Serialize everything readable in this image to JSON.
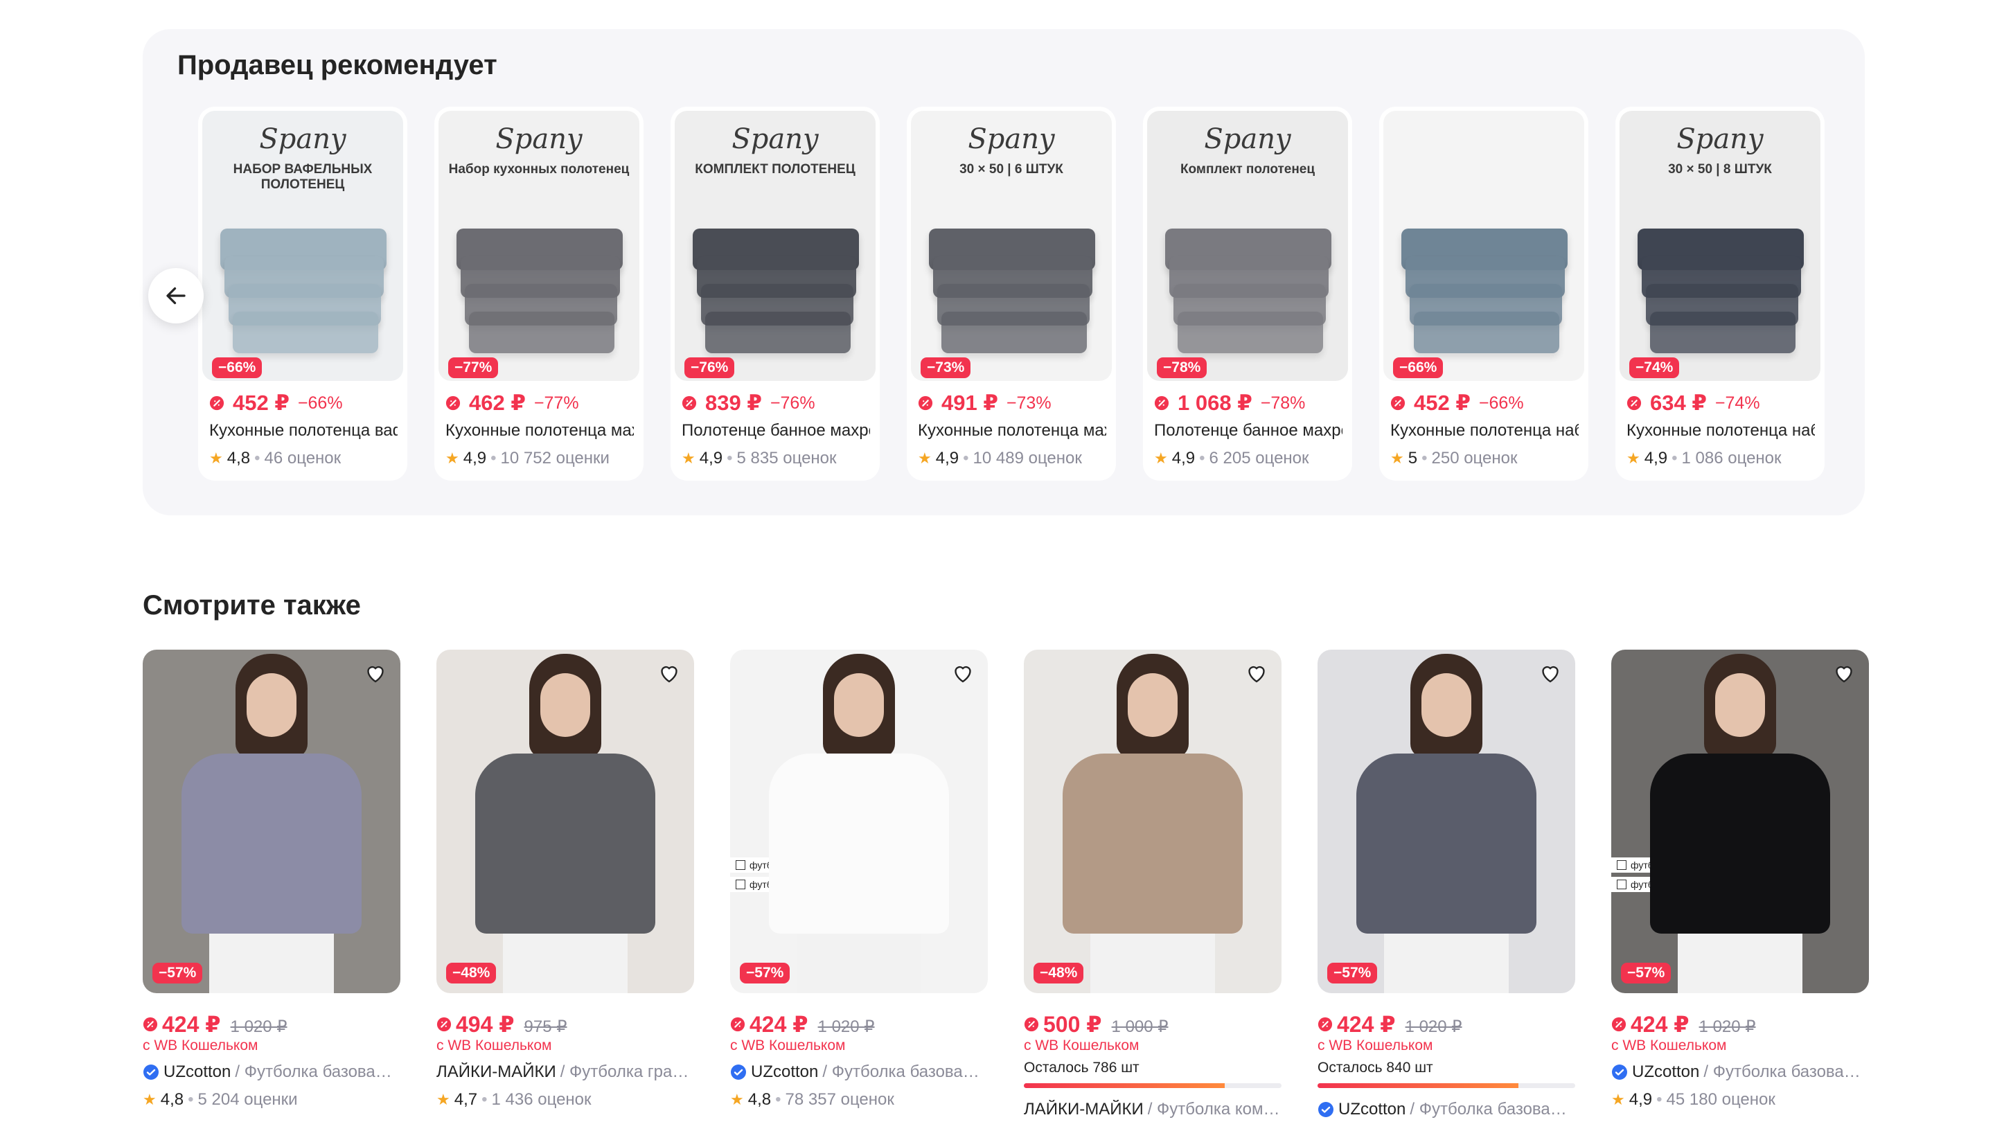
{
  "recommend": {
    "title": "Продавец рекомендует",
    "prev_icon": "arrow-left-icon",
    "cards": [
      {
        "brand": "Spany",
        "caption": "НАБОР ВАФЕЛЬНЫХ ПОЛОТЕНЕЦ",
        "discount": "−66%",
        "price": "452 ₽",
        "price_discount": "−66%",
        "name": "Кухонные полотенца вафельные",
        "rating": "4,8",
        "reviews": "46 оценок",
        "bg": "#eef0f2",
        "towel": "#9fb3bf"
      },
      {
        "brand": "Spany",
        "caption": "Набор кухонных полотенец",
        "discount": "−77%",
        "price": "462 ₽",
        "price_discount": "−77%",
        "name": "Кухонные полотенца махровые",
        "rating": "4,9",
        "reviews": "10 752 оценки",
        "bg": "#f1f1f1",
        "towel": "#6c6c72"
      },
      {
        "brand": "Spany",
        "caption": "КОМПЛЕКТ ПОЛОТЕНЕЦ",
        "discount": "−76%",
        "price": "839 ₽",
        "price_discount": "−76%",
        "name": "Полотенце банное махровое",
        "rating": "4,9",
        "reviews": "5 835 оценок",
        "bg": "#eeeeee",
        "towel": "#4a4d55"
      },
      {
        "brand": "Spany",
        "caption": "30 × 50 | 6 ШТУК",
        "discount": "−73%",
        "price": "491 ₽",
        "price_discount": "−73%",
        "name": "Кухонные полотенца махровые",
        "rating": "4,9",
        "reviews": "10 489 оценок",
        "bg": "#f3f3f3",
        "towel": "#5f6168"
      },
      {
        "brand": "Spany",
        "caption": "Комплект полотенец",
        "discount": "−78%",
        "price": "1 068 ₽",
        "price_discount": "−78%",
        "name": "Полотенце банное махровое",
        "rating": "4,9",
        "reviews": "6 205 оценок",
        "bg": "#ececec",
        "towel": "#7a7a80"
      },
      {
        "brand": "",
        "caption": "",
        "discount": "−66%",
        "price": "452 ₽",
        "price_discount": "−66%",
        "name": "Кухонные полотенца набор",
        "rating": "5",
        "reviews": "250 оценок",
        "bg": "#f4f4f4",
        "towel": "#6f8596"
      },
      {
        "brand": "Spany",
        "caption": "30 × 50 | 8 ШТУК",
        "discount": "−74%",
        "price": "634 ₽",
        "price_discount": "−74%",
        "name": "Кухонные полотенца набор",
        "rating": "4,9",
        "reviews": "1 086 оценок",
        "bg": "#ececec",
        "towel": "#3f4552"
      }
    ]
  },
  "see_also": {
    "title": "Смотрите также",
    "cards": [
      {
        "discount": "−57%",
        "price": "424 ₽",
        "old_price": "1 020 ₽",
        "wallet": "с WB Кошельком",
        "stock": "",
        "brand": "UZcotton",
        "product": "/ Футболка базовая оверсайз",
        "verified": true,
        "rating": "4,8",
        "reviews": "5 204 оценки",
        "bg": "#8d8a86",
        "shirt": "#8c8ca6"
      },
      {
        "discount": "−48%",
        "price": "494 ₽",
        "old_price": "975 ₽",
        "wallet": "с WB Кошельком",
        "stock": "",
        "brand": "ЛАЙКИ-МАЙКИ",
        "product": "/ Футболка граненая",
        "verified": false,
        "rating": "4,7",
        "reviews": "1 436 оценок",
        "bg": "#e7e3df",
        "shirt": "#5d5e63"
      },
      {
        "discount": "−57%",
        "price": "424 ₽",
        "old_price": "1 020 ₽",
        "wallet": "с WB Кошельком",
        "stock": "",
        "brand": "UZcotton",
        "product": "/ Футболка базовая оверсайз",
        "verified": true,
        "rating": "4,8",
        "reviews": "78 357 оценок",
        "bg": "#f3f3f3",
        "shirt": "#fbfbfb"
      },
      {
        "discount": "−48%",
        "price": "500 ₽",
        "old_price": "1 000 ₽",
        "wallet": "с WB Кошельком",
        "stock": "Осталось 786 шт",
        "brand": "ЛАЙКИ-МАЙКИ",
        "product": "/ Футболка комфорт",
        "verified": false,
        "rating": "",
        "reviews": "",
        "bg": "#e9e7e4",
        "shirt": "#b39a86"
      },
      {
        "discount": "−57%",
        "price": "424 ₽",
        "old_price": "1 020 ₽",
        "wallet": "с WB Кошельком",
        "stock": "Осталось 840 шт",
        "brand": "UZcotton",
        "product": "/ Футболка базовая оверсайз",
        "verified": true,
        "rating": "",
        "reviews": "",
        "bg": "#dfdfe2",
        "shirt": "#5a5d6b"
      },
      {
        "discount": "−57%",
        "price": "424 ₽",
        "old_price": "1 020 ₽",
        "wallet": "с WB Кошельком",
        "stock": "",
        "brand": "UZcotton",
        "product": "/ Футболка базовая оверсайз",
        "verified": true,
        "rating": "4,9",
        "reviews": "45 180 оценок",
        "bg": "#6e6c6a",
        "shirt": "#111113"
      }
    ],
    "tags": [
      "футболка прямого кроя",
      "футболка А-силуэт"
    ]
  }
}
